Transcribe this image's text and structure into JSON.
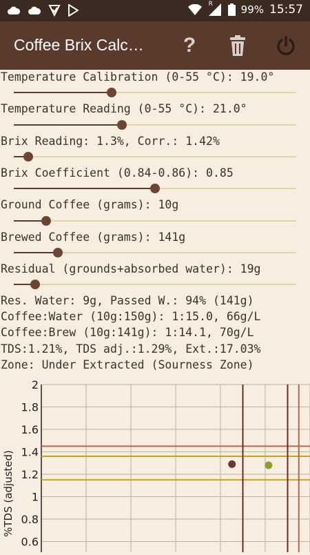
{
  "status_bar": {
    "battery": "99%",
    "time": "15:57",
    "network_badge": "R"
  },
  "app_bar": {
    "title": "Coffee Brix Calc…",
    "icons": [
      "help-icon",
      "trash-icon",
      "power-icon"
    ]
  },
  "sliders": [
    {
      "label": "Temperature Calibration (0-55 °C): 19.0°",
      "value": 19.0,
      "min": 0,
      "max": 55
    },
    {
      "label": "Temperature Reading (0-55 °C): 21.0°",
      "value": 21.0,
      "min": 0,
      "max": 55
    },
    {
      "label": "Brix Reading: 1.3%,  Corr.: 1.42%",
      "fraction": 0.05
    },
    {
      "label": "Brix Coefficient (0.84-0.86): 0.85",
      "fraction": 0.5
    },
    {
      "label": "Ground Coffee (grams): 10g",
      "fraction": 0.115
    },
    {
      "label": "Brewed Coffee (grams): 141g",
      "fraction": 0.155
    },
    {
      "label": "Residual (grounds+absorbed water): 19g",
      "fraction": 0.075
    }
  ],
  "results": [
    "Res. Water: 9g,  Passed W.: 94% (141g)",
    "Coffee:Water (10g:150g): 1:15.0, 66g/L",
    "Coffee:Brew (10g:141g): 1:14.1, 70g/L",
    "TDS:1.21%, TDS adj.:1.29%, Ext.:17.03%",
    "Zone: Under Extracted (Sourness Zone)"
  ],
  "chart_data": {
    "type": "scatter",
    "ylabel": "%TDS (adjusted)",
    "ylim": [
      0.6,
      2.0
    ],
    "yticks": [
      "2",
      "1.8",
      "1.6",
      "1.4",
      "1.2",
      "1",
      "0.8",
      "0.6"
    ],
    "xlim": [
      0,
      24
    ],
    "grid": true,
    "points": [
      {
        "x": 17.03,
        "y": 1.29,
        "color": "#6b3a2a"
      },
      {
        "x": 20.3,
        "y": 1.28,
        "color": "#8aa128"
      }
    ],
    "reference_lines": {
      "vertical": [
        {
          "x": 18,
          "color": "#6b2a1f"
        },
        {
          "x": 22,
          "color": "#6b2a1f"
        },
        {
          "x": 23,
          "color": "#b06a4a"
        }
      ],
      "horizontal": [
        {
          "y": 1.45,
          "color": "#b06a4a"
        },
        {
          "y": 1.36,
          "color": "#c9a218"
        },
        {
          "y": 1.15,
          "color": "#c9a218"
        }
      ]
    }
  },
  "colors": {
    "appbar": "#5a3a2c",
    "statusbar": "#3b2a22",
    "background": "#f8ede1",
    "thumb": "#6e4533",
    "track": "#e3d3a8"
  }
}
